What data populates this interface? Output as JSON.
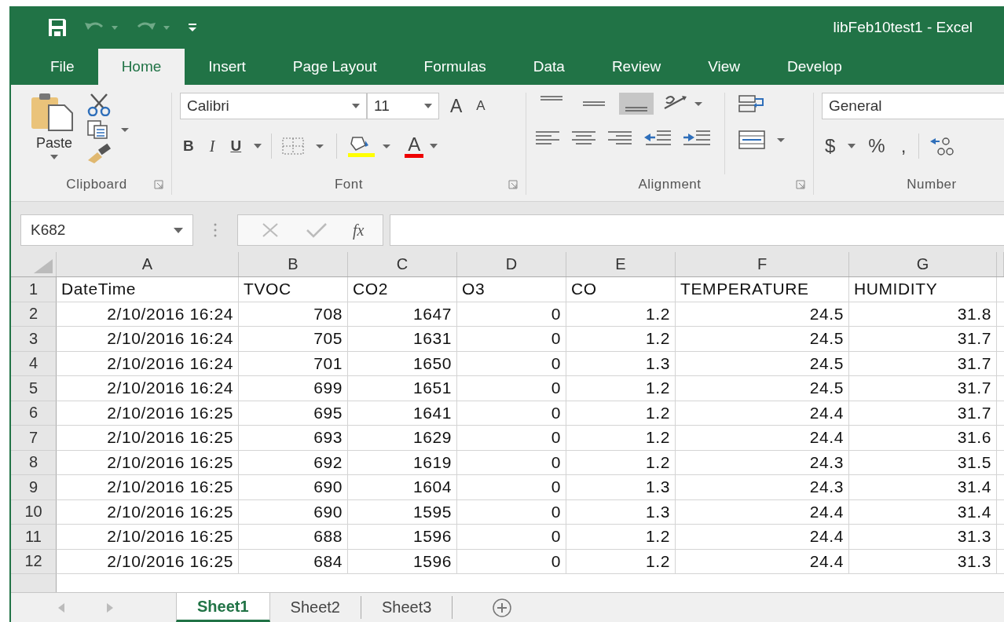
{
  "window": {
    "title": "libFeb10test1 - Excel"
  },
  "tabs": [
    {
      "label": "File",
      "selected": false
    },
    {
      "label": "Home",
      "selected": true
    },
    {
      "label": "Insert",
      "selected": false
    },
    {
      "label": "Page Layout",
      "selected": false
    },
    {
      "label": "Formulas",
      "selected": false
    },
    {
      "label": "Data",
      "selected": false
    },
    {
      "label": "Review",
      "selected": false
    },
    {
      "label": "View",
      "selected": false
    },
    {
      "label": "Develop",
      "selected": false
    }
  ],
  "ribbon": {
    "clipboard": {
      "paste_label": "Paste",
      "group_label": "Clipboard"
    },
    "font": {
      "name": "Calibri",
      "size": "11",
      "grow": "A",
      "shrink": "A",
      "bold": "B",
      "italic": "I",
      "underline": "U",
      "font_color": "A",
      "group_label": "Font"
    },
    "alignment": {
      "vertical": [
        {
          "selected": false
        },
        {
          "selected": false
        },
        {
          "selected": true
        }
      ],
      "group_label": "Alignment"
    },
    "number": {
      "format": "General",
      "currency": "$",
      "percent": "%",
      "comma": ",",
      "group_label": "Number"
    }
  },
  "formula_bar": {
    "name_box": "K682",
    "function_label": "fx"
  },
  "sheet": {
    "columns": [
      "A",
      "B",
      "C",
      "D",
      "E",
      "F",
      "G"
    ],
    "rows": [
      {
        "number": "1",
        "kind": "header",
        "cells": [
          "DateTime",
          "TVOC",
          "CO2",
          "O3",
          "CO",
          "TEMPERATURE",
          "HUMIDITY"
        ]
      },
      {
        "number": "2",
        "kind": "data",
        "cells": [
          "2/10/2016 16:24",
          "708",
          "1647",
          "0",
          "1.2",
          "24.5",
          "31.8"
        ]
      },
      {
        "number": "3",
        "kind": "data",
        "cells": [
          "2/10/2016 16:24",
          "705",
          "1631",
          "0",
          "1.2",
          "24.5",
          "31.7"
        ]
      },
      {
        "number": "4",
        "kind": "data",
        "cells": [
          "2/10/2016 16:24",
          "701",
          "1650",
          "0",
          "1.3",
          "24.5",
          "31.7"
        ]
      },
      {
        "number": "5",
        "kind": "data",
        "cells": [
          "2/10/2016 16:24",
          "699",
          "1651",
          "0",
          "1.2",
          "24.5",
          "31.7"
        ]
      },
      {
        "number": "6",
        "kind": "data",
        "cells": [
          "2/10/2016 16:25",
          "695",
          "1641",
          "0",
          "1.2",
          "24.4",
          "31.7"
        ]
      },
      {
        "number": "7",
        "kind": "data",
        "cells": [
          "2/10/2016 16:25",
          "693",
          "1629",
          "0",
          "1.2",
          "24.4",
          "31.6"
        ]
      },
      {
        "number": "8",
        "kind": "data",
        "cells": [
          "2/10/2016 16:25",
          "692",
          "1619",
          "0",
          "1.2",
          "24.3",
          "31.5"
        ]
      },
      {
        "number": "9",
        "kind": "data",
        "cells": [
          "2/10/2016 16:25",
          "690",
          "1604",
          "0",
          "1.3",
          "24.3",
          "31.4"
        ]
      },
      {
        "number": "10",
        "kind": "data",
        "cells": [
          "2/10/2016 16:25",
          "690",
          "1595",
          "0",
          "1.3",
          "24.4",
          "31.4"
        ]
      },
      {
        "number": "11",
        "kind": "data",
        "cells": [
          "2/10/2016 16:25",
          "688",
          "1596",
          "0",
          "1.2",
          "24.4",
          "31.3"
        ]
      },
      {
        "number": "12",
        "kind": "data",
        "cells": [
          "2/10/2016 16:25",
          "684",
          "1596",
          "0",
          "1.2",
          "24.4",
          "31.3"
        ]
      }
    ]
  },
  "sheet_tabs": [
    {
      "label": "Sheet1",
      "selected": true
    },
    {
      "label": "Sheet2",
      "selected": false
    },
    {
      "label": "Sheet3",
      "selected": false
    }
  ]
}
